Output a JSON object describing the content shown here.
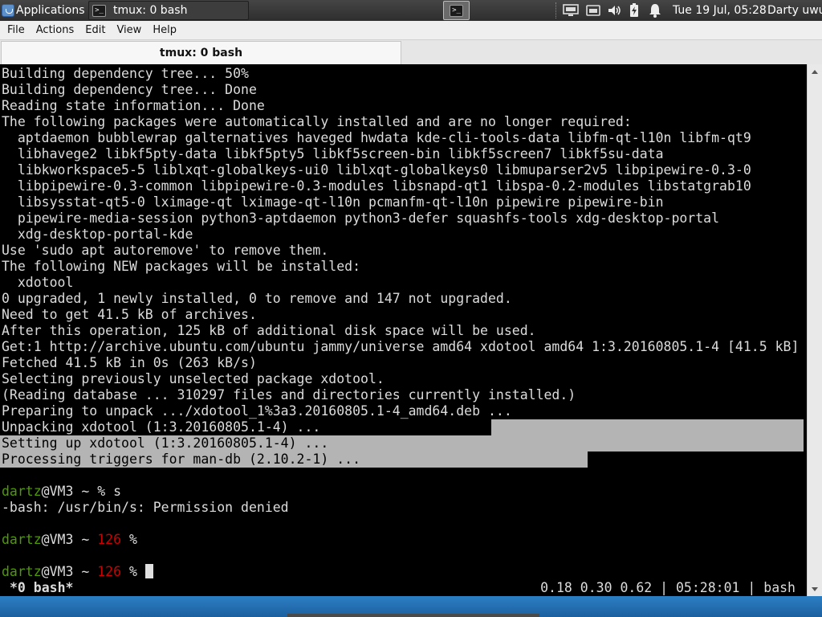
{
  "panel": {
    "applications_label": "Applications",
    "task_label": "tmux: 0 bash",
    "clock": "Tue 19 Jul, 05:28",
    "user": "Darty uwu",
    "icons": [
      "applications-icon",
      "terminal-icon",
      "display-icon",
      "window-icon",
      "volume-icon",
      "battery-icon",
      "notification-bell-icon"
    ]
  },
  "menubar": {
    "file": "File",
    "actions": "Actions",
    "edit": "Edit",
    "view": "View",
    "help": "Help"
  },
  "tab": {
    "label": "tmux: 0 bash"
  },
  "terminal": {
    "lines": [
      "Building dependency tree... 50%",
      "Building dependency tree... Done",
      "Reading state information... Done",
      "The following packages were automatically installed and are no longer required:",
      "  aptdaemon bubblewrap galternatives haveged hwdata kde-cli-tools-data libfm-qt-l10n libfm-qt9",
      "  libhavege2 libkf5pty-data libkf5pty5 libkf5screen-bin libkf5screen7 libkf5su-data",
      "  libkworkspace5-5 liblxqt-globalkeys-ui0 liblxqt-globalkeys0 libmuparser2v5 libpipewire-0.3-0",
      "  libpipewire-0.3-common libpipewire-0.3-modules libsnapd-qt1 libspa-0.2-modules libstatgrab10",
      "  libsysstat-qt5-0 lximage-qt lximage-qt-l10n pcmanfm-qt-l10n pipewire pipewire-bin",
      "  pipewire-media-session python3-aptdaemon python3-defer squashfs-tools xdg-desktop-portal",
      "  xdg-desktop-portal-kde",
      "Use 'sudo apt autoremove' to remove them.",
      "The following NEW packages will be installed:",
      "  xdotool",
      "0 upgraded, 1 newly installed, 0 to remove and 147 not upgraded.",
      "Need to get 41.5 kB of archives.",
      "After this operation, 125 kB of additional disk space will be used.",
      "Get:1 http://archive.ubuntu.com/ubuntu jammy/universe amd64 xdotool amd64 1:3.20160805.1-4 [41.5 kB]",
      "Fetched 41.5 kB in 0s (263 kB/s)",
      "Selecting previously unselected package xdotool.",
      "(Reading database ... 310297 files and directories currently installed.)",
      "Preparing to unpack .../xdotool_1%3a3.20160805.1-4_amd64.deb ...",
      "Unpacking xdotool (1:3.20160805.1-4) ...",
      "Setting up xdotool (1:3.20160805.1-4) ...",
      "Processing triggers for man-db (2.10.2-1) ..."
    ],
    "prompt_user": "dartz",
    "prompt_host_path": "@VM3 ~ ",
    "cmd1_status": "%",
    "cmd1": " s",
    "error": "-bash: /usr/bin/s: Permission denied",
    "status_code": "126",
    "prompt_suffix": " %"
  },
  "tmux_status": {
    "left": "*0 bash*",
    "right": "0.18 0.30 0.62 | 05:28:01 | bash"
  }
}
